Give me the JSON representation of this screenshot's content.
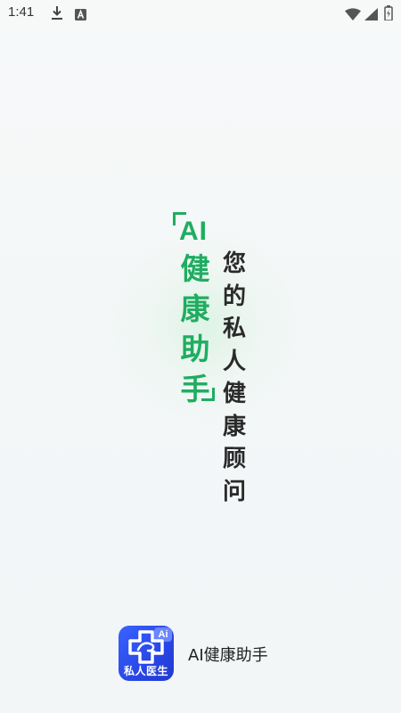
{
  "status_bar": {
    "time": "1:41",
    "icons": [
      "download-icon",
      "a-notification-icon",
      "wifi-icon",
      "signal-icon",
      "battery-icon"
    ]
  },
  "headline": {
    "ai": "AI",
    "title": "健康助手",
    "tagline": "您的私人健康顾问"
  },
  "brand": {
    "logo_badge": "Ai",
    "logo_text": "私人医生",
    "app_name": "AI健康助手"
  },
  "colors": {
    "accent_green": "#1fad60",
    "logo_blue": "#2e4ef2",
    "text_dark": "#2a2a2a"
  }
}
